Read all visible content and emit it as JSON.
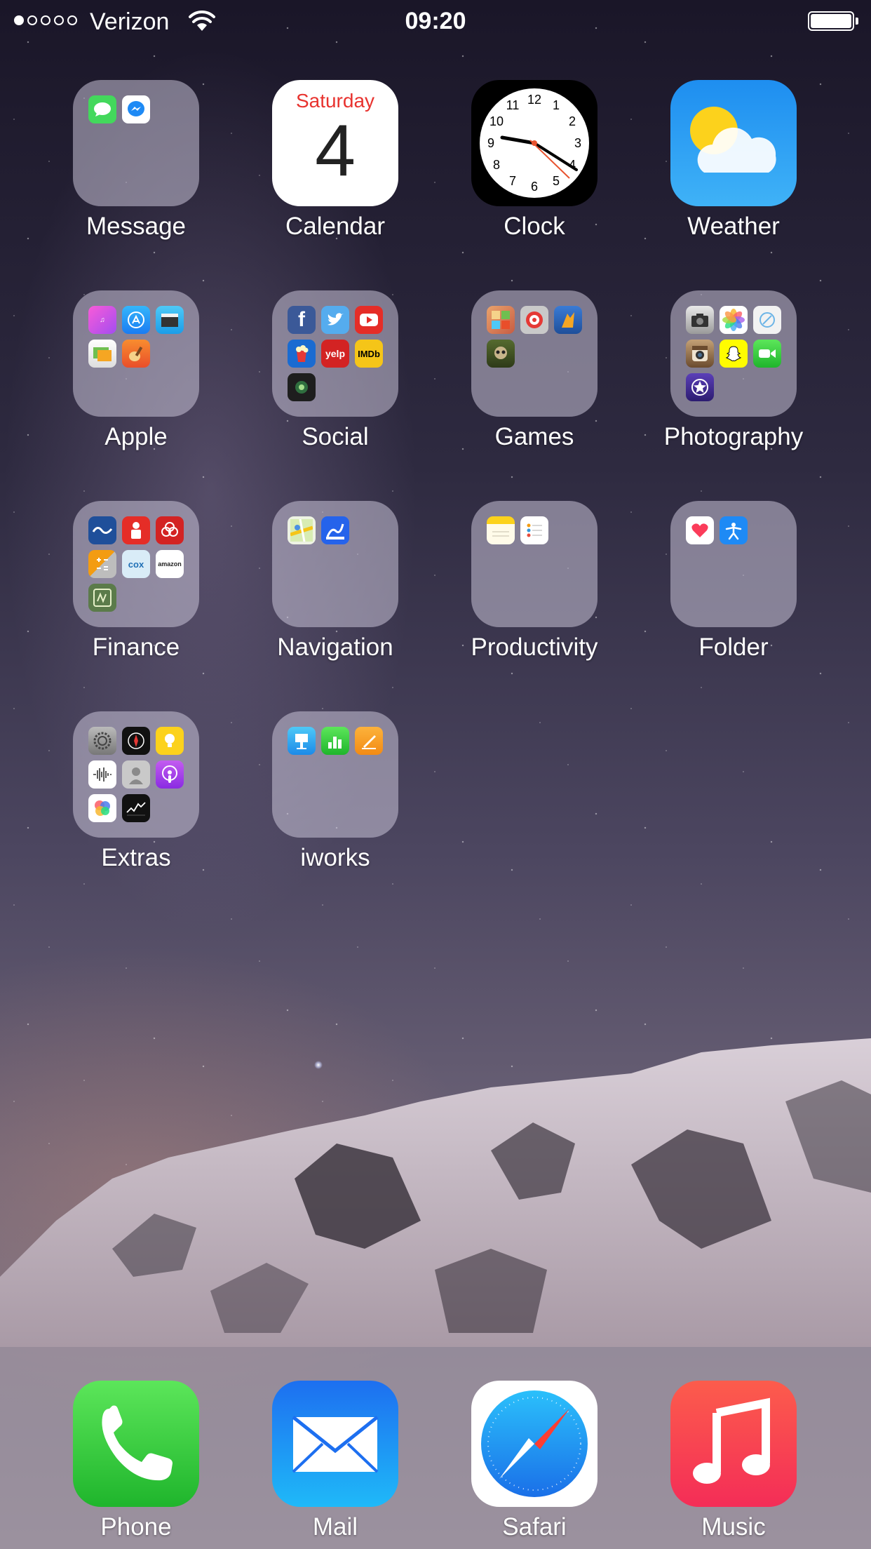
{
  "status_bar": {
    "carrier": "Verizon",
    "time": "09:20",
    "signal_filled": 1,
    "signal_total": 5
  },
  "apps": [
    {
      "id": "message",
      "label": "Message",
      "type": "folder"
    },
    {
      "id": "calendar",
      "label": "Calendar",
      "type": "app",
      "weekday": "Saturday",
      "day": "4"
    },
    {
      "id": "clock",
      "label": "Clock",
      "type": "app"
    },
    {
      "id": "weather",
      "label": "Weather",
      "type": "app"
    },
    {
      "id": "apple",
      "label": "Apple",
      "type": "folder"
    },
    {
      "id": "social",
      "label": "Social",
      "type": "folder"
    },
    {
      "id": "games",
      "label": "Games",
      "type": "folder"
    },
    {
      "id": "photography",
      "label": "Photography",
      "type": "folder"
    },
    {
      "id": "finance",
      "label": "Finance",
      "type": "folder"
    },
    {
      "id": "navigation",
      "label": "Navigation",
      "type": "folder"
    },
    {
      "id": "productivity",
      "label": "Productivity",
      "type": "folder"
    },
    {
      "id": "folder",
      "label": "Folder",
      "type": "folder"
    },
    {
      "id": "extras",
      "label": "Extras",
      "type": "folder"
    },
    {
      "id": "iworks",
      "label": "iworks",
      "type": "folder"
    }
  ],
  "clock_face": {
    "numbers": [
      "12",
      "1",
      "2",
      "3",
      "4",
      "5",
      "6",
      "7",
      "8",
      "9",
      "10",
      "11"
    ]
  },
  "folder_contents": {
    "social": {
      "yelp": "yelp",
      "imdb": "IMDb"
    },
    "finance": {
      "cox": "cox",
      "amazon": "amazon"
    }
  },
  "dock": [
    {
      "id": "phone",
      "label": "Phone"
    },
    {
      "id": "mail",
      "label": "Mail"
    },
    {
      "id": "safari",
      "label": "Safari"
    },
    {
      "id": "music",
      "label": "Music"
    }
  ],
  "colors": {
    "folder_bg": "#c8c3d7",
    "calendar_red": "#e8332f",
    "phone_green": "#1fb52c",
    "mail_blue": "#1d6ff0",
    "music_red": "#f42d57"
  }
}
